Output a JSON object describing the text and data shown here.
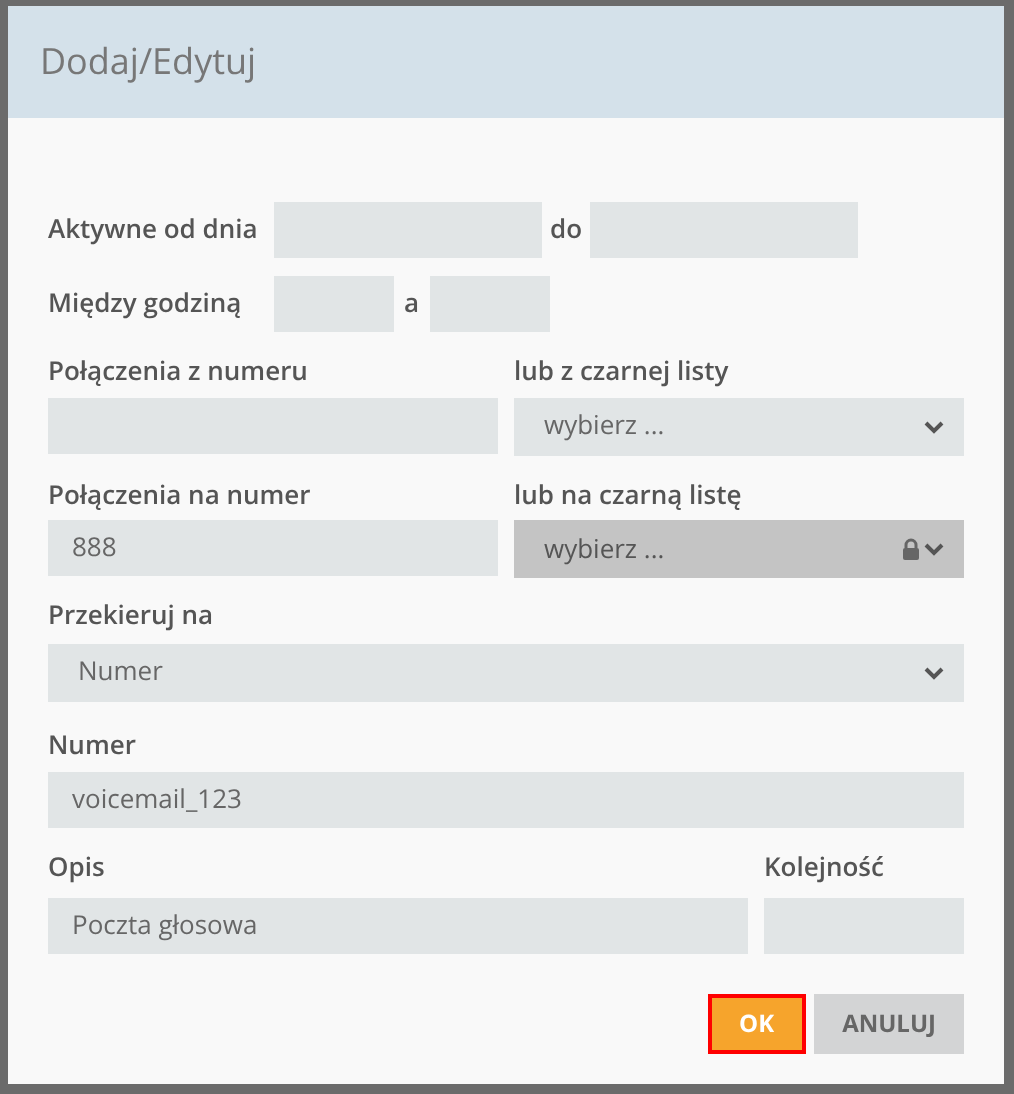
{
  "dialog": {
    "title": "Dodaj/Edytuj"
  },
  "active_range": {
    "label": "Aktywne od dnia",
    "separator": "do"
  },
  "hour_range": {
    "label": "Między godziną",
    "separator": "a"
  },
  "rows": [
    {
      "left": {
        "label": "Połączenia z numeru",
        "kind": "input"
      },
      "right": {
        "label": "lub z czarnej listy",
        "kind": "select",
        "value": "wybierz ...",
        "disabled": false
      }
    },
    {
      "left": {
        "label": "Połączenia na numer",
        "kind": "input",
        "value": "888"
      },
      "right": {
        "label": "lub na czarną listę",
        "kind": "select",
        "value": "wybierz ...",
        "disabled": true
      }
    }
  ],
  "redirect": {
    "label": "Przekieruj na",
    "kind": "select",
    "value": "Numer",
    "disabled": false
  },
  "number": {
    "label": "Numer",
    "kind": "input",
    "value": "voicemail_123"
  },
  "description": {
    "label": "Opis",
    "value": "Poczta głosowa"
  },
  "order": {
    "label": "Kolejność"
  },
  "buttons": [
    {
      "label": "OK",
      "kind": "primary",
      "highlighted": true
    },
    {
      "label": "ANULUJ",
      "kind": "secondary",
      "highlighted": false
    }
  ]
}
